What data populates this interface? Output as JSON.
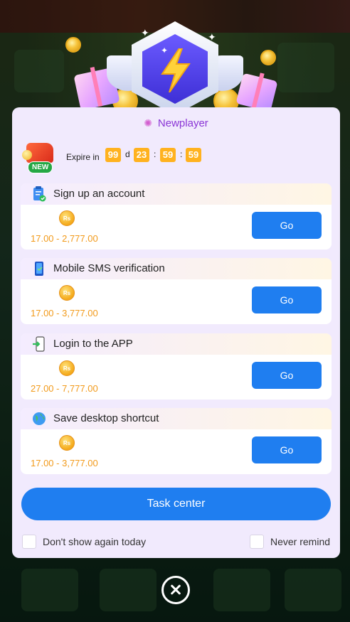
{
  "modal": {
    "title": "Newplayer",
    "title_icon": "gift-sparkle-icon",
    "new_badge_label": "NEW",
    "expire_label": "Expire in",
    "countdown": {
      "days": "99",
      "day_unit": "d",
      "hours": "23",
      "minutes": "59",
      "seconds": "59",
      "separator": ":"
    },
    "tasks": [
      {
        "title": "Sign up an account",
        "icon": "clipboard-check-icon",
        "coin_label": "Rs",
        "range": "17.00 - 2,777.00",
        "button": "Go"
      },
      {
        "title": "Mobile SMS verification",
        "icon": "phone-icon",
        "coin_label": "Rs",
        "range": "17.00 - 3,777.00",
        "button": "Go"
      },
      {
        "title": "Login to the APP",
        "icon": "phone-login-icon",
        "coin_label": "Rs",
        "range": "27.00 - 7,777.00",
        "button": "Go"
      },
      {
        "title": "Save desktop shortcut",
        "icon": "globe-icon",
        "coin_label": "Rs",
        "range": "17.00 - 3,777.00",
        "button": "Go"
      }
    ],
    "task_center_label": "Task center",
    "dont_show_today_label": "Don't show again today",
    "never_remind_label": "Never remind"
  },
  "colors": {
    "primary": "#1f7ef0",
    "accent_orange": "#ffb21f",
    "reward_text": "#f29a1a",
    "title_purple": "#8a35d6",
    "modal_bg": "#f1eafd"
  }
}
